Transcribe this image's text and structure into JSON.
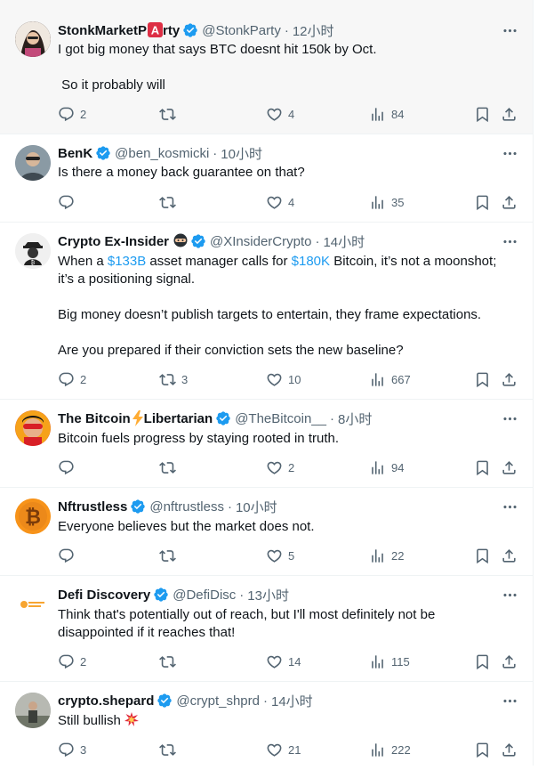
{
  "tweets": [
    {
      "name": "StonkMarketP",
      "name_suffix": "rty",
      "handle": "@StonkParty",
      "time": "12小时",
      "text": "I got big money that says BTC doesnt hit 150k by Oct.\n\n So it probably will",
      "replies": "2",
      "reposts": "",
      "likes": "4",
      "views": "84",
      "avatar_color": "#3a2c2a"
    },
    {
      "name": "BenK",
      "handle": "@ben_kosmicki",
      "time": "10小时",
      "text": "Is there a money back guarantee on that?",
      "replies": "",
      "reposts": "",
      "likes": "4",
      "views": "35",
      "avatar_color": "#6b7c8a"
    },
    {
      "name": "Crypto Ex-Insider",
      "handle": "@XInsiderCrypto",
      "time": "14小时",
      "text_parts": [
        "When a ",
        "$133B",
        " asset manager calls for ",
        "$180K",
        " Bitcoin, it’s not a moonshot; it’s a positioning signal.\n\nBig money doesn’t publish targets to entertain, they frame expectations.\n\nAre you prepared if their conviction sets the new baseline?"
      ],
      "replies": "2",
      "reposts": "3",
      "likes": "10",
      "views": "667",
      "avatar_color": "#e9e9e9"
    },
    {
      "name": "The Bitcoin",
      "name_suffix": "Libertarian",
      "handle": "@TheBitcoin__",
      "time": "8小时",
      "text": "Bitcoin fuels progress by staying rooted in truth.",
      "replies": "",
      "reposts": "",
      "likes": "2",
      "views": "94",
      "avatar_color": "#c8102e"
    },
    {
      "name": "Nftrustless",
      "handle": "@nftrustless",
      "time": "10小时",
      "text": "Everyone believes but the market does not.",
      "replies": "",
      "reposts": "",
      "likes": "5",
      "views": "22",
      "avatar_color": "#f7931a"
    },
    {
      "name": "Defi Discovery",
      "handle": "@DefiDisc",
      "time": "13小时",
      "text": "Think that's potentially out of reach, but I'll most definitely not be disappointed if it reaches that!",
      "replies": "2",
      "reposts": "",
      "likes": "14",
      "views": "115",
      "avatar_color": "#ffffff"
    },
    {
      "name": "crypto.shepard",
      "handle": "@crypt_shprd",
      "time": "14小时",
      "text": "Still bullish",
      "replies": "3",
      "reposts": "",
      "likes": "21",
      "views": "222",
      "avatar_color": "#8a8f86"
    }
  ],
  "icons": {
    "reply": "reply-icon",
    "repost": "repost-icon",
    "like": "like-icon",
    "views": "views-icon",
    "bookmark": "bookmark-icon",
    "share": "share-icon",
    "more": "more-icon",
    "verified": "verified-badge-icon"
  },
  "colors": {
    "accent": "#1d9bf0",
    "secondary_text": "#536471",
    "highlight_bg": "#f7f7f7"
  }
}
